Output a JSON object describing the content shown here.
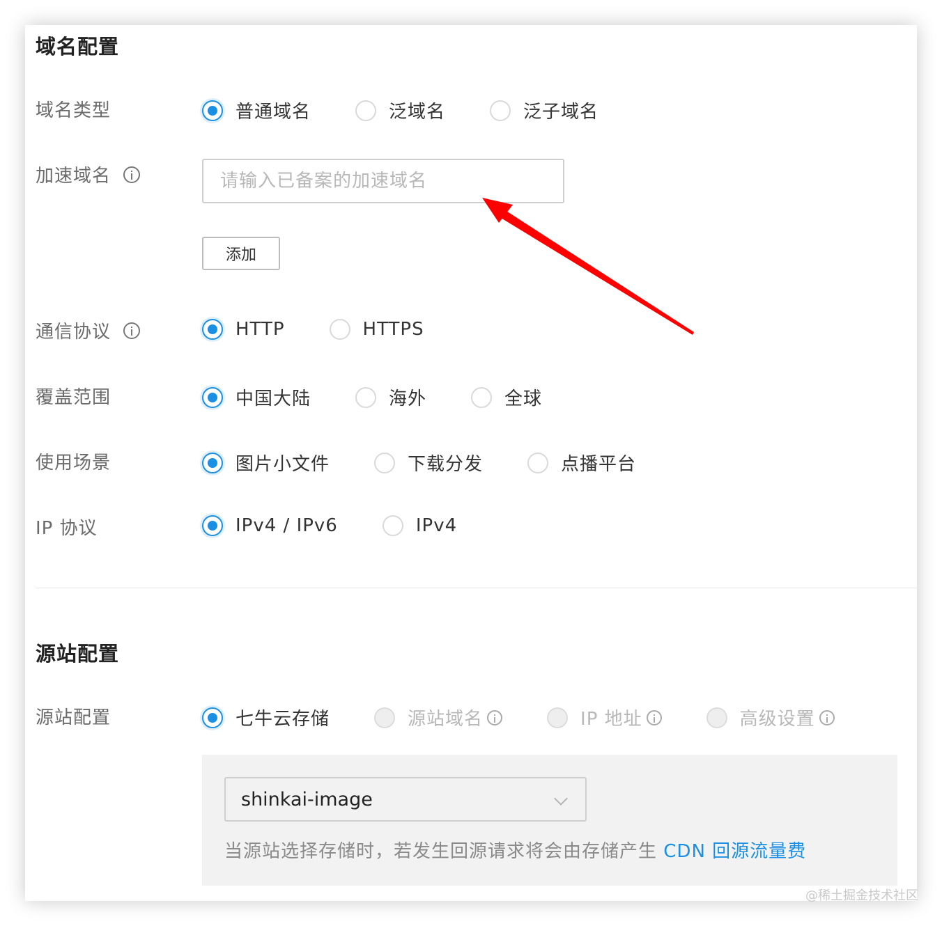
{
  "domain_config": {
    "title": "域名配置",
    "domain_type": {
      "label": "域名类型",
      "options": [
        "普通域名",
        "泛域名",
        "泛子域名"
      ],
      "selected": "普通域名"
    },
    "accel_domain": {
      "label": "加速域名",
      "placeholder": "请输入已备案的加速域名",
      "add_button": "添加"
    },
    "protocol": {
      "label": "通信协议",
      "options": [
        "HTTP",
        "HTTPS"
      ],
      "selected": "HTTP"
    },
    "coverage": {
      "label": "覆盖范围",
      "options": [
        "中国大陆",
        "海外",
        "全球"
      ],
      "selected": "中国大陆"
    },
    "scenario": {
      "label": "使用场景",
      "options": [
        "图片小文件",
        "下载分发",
        "点播平台"
      ],
      "selected": "图片小文件"
    },
    "ip_protocol": {
      "label": "IP 协议",
      "options": [
        "IPv4 / IPv6",
        "IPv4"
      ],
      "selected": "IPv4 / IPv6"
    }
  },
  "origin_config": {
    "title": "源站配置",
    "label": "源站配置",
    "options": [
      "七牛云存储",
      "源站域名",
      "IP 地址",
      "高级设置"
    ],
    "selected": "七牛云存储",
    "bucket_value": "shinkai-image",
    "note_text": "当源站选择存储时，若发生回源请求将会由存储产生 ",
    "note_link": "CDN 回源流量费"
  },
  "watermark": "@稀土掘金技术社区",
  "colors": {
    "accent": "#1a8fe3",
    "arrow": "#ff0000"
  }
}
